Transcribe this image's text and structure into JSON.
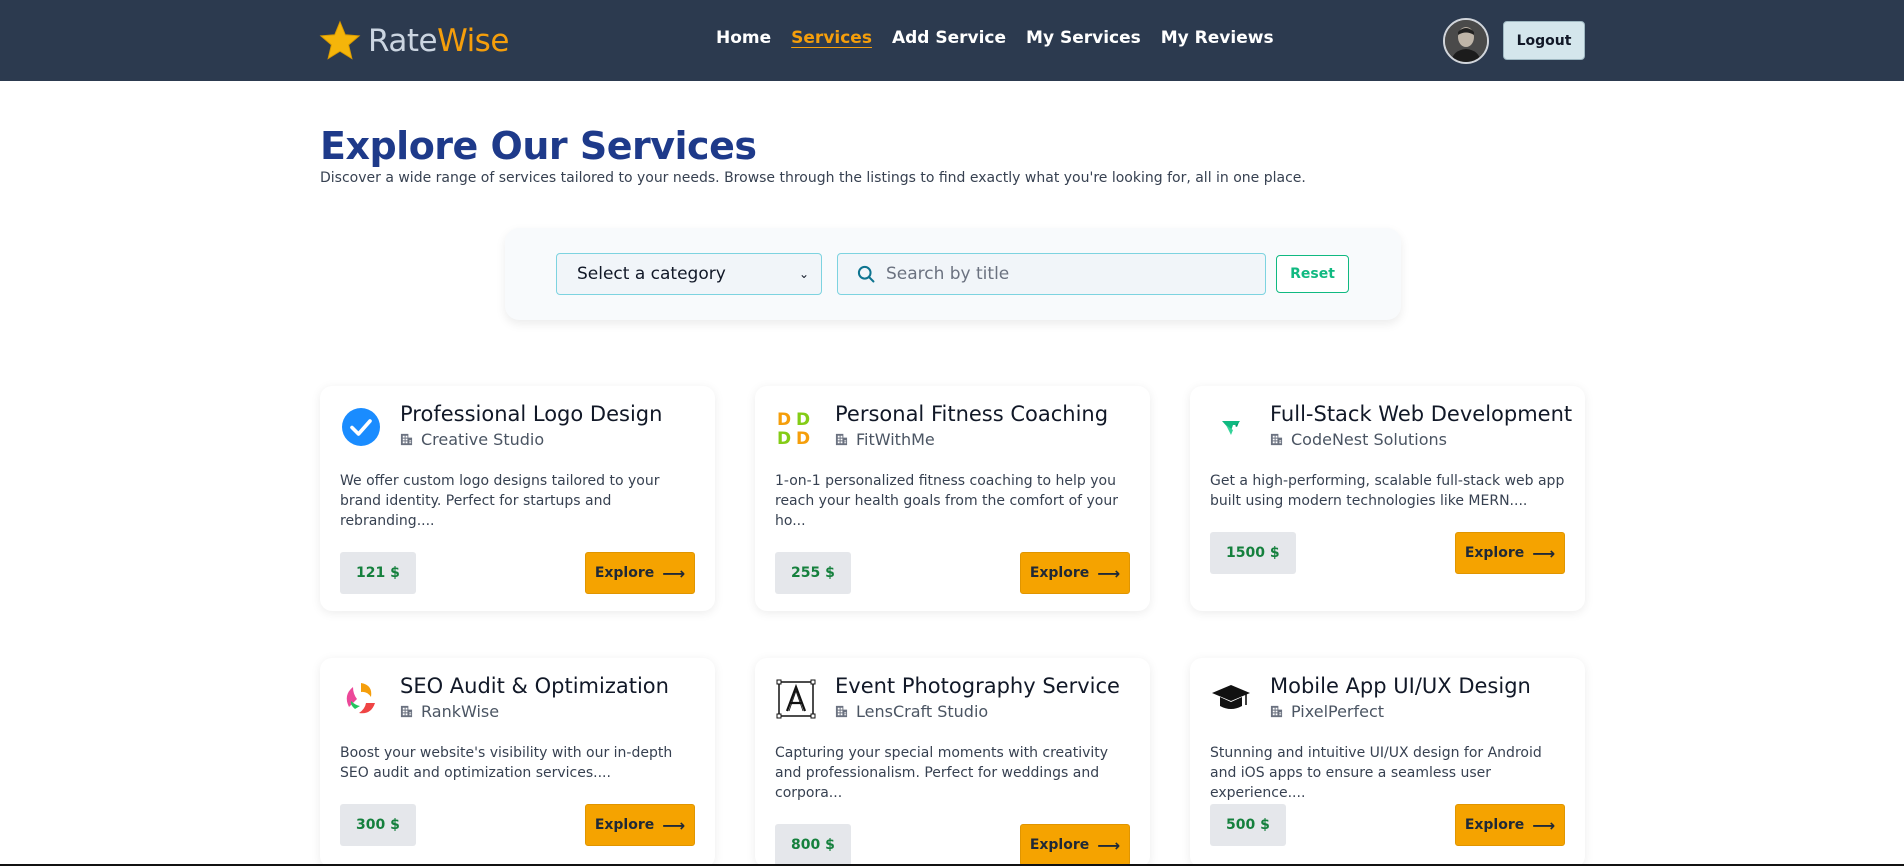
{
  "brand": {
    "rate": "Rate",
    "wise": "Wise",
    "star_color": "#f5b50a"
  },
  "nav": {
    "links": [
      {
        "label": "Home",
        "active": false
      },
      {
        "label": "Services",
        "active": true
      },
      {
        "label": "Add Service",
        "active": false
      },
      {
        "label": "My Services",
        "active": false
      },
      {
        "label": "My Reviews",
        "active": false
      }
    ],
    "logout_label": "Logout"
  },
  "header": {
    "title": "Explore Our Services",
    "subtitle": "Discover a wide range of services tailored to your needs. Browse through the listings to find exactly what you're looking for, all in one place."
  },
  "filters": {
    "category_selected": "Select a category",
    "search_placeholder": "Search by title",
    "reset_label": "Reset"
  },
  "services": [
    {
      "title": "Professional Logo Design",
      "company": "Creative Studio",
      "description": "We offer custom logo designs tailored to your brand identity. Perfect for startups and rebranding....",
      "price": "121 $",
      "explore_label": "Explore",
      "icon": "checkmark-badge-icon"
    },
    {
      "title": "Personal Fitness Coaching",
      "company": "FitWithMe",
      "description": "1-on-1 personalized fitness coaching to help you reach your health goals from the comfort of your ho...",
      "price": "255 $",
      "explore_label": "Explore",
      "icon": "dd-pattern-icon"
    },
    {
      "title": "Full-Stack Web Development",
      "company": "CodeNest Solutions",
      "description": "Get a high-performing, scalable full-stack web app built using modern technologies like MERN....",
      "price": "1500 $",
      "explore_label": "Explore",
      "icon": "green-v-icon"
    },
    {
      "title": "SEO Audit & Optimization",
      "company": "RankWise",
      "description": "Boost your website's visibility with our in-depth SEO audit and optimization services....",
      "price": "300 $",
      "explore_label": "Explore",
      "icon": "swirl-icon"
    },
    {
      "title": "Event Photography Service",
      "company": "LensCraft Studio",
      "description": "Capturing your special moments with creativity and professionalism. Perfect for weddings and corpora...",
      "price": "800 $",
      "explore_label": "Explore",
      "icon": "letter-a-frame-icon"
    },
    {
      "title": "Mobile App UI/UX Design",
      "company": "PixelPerfect",
      "description": "Stunning and intuitive UI/UX design for Android and iOS apps to ensure a seamless user experience....",
      "price": "500 $",
      "explore_label": "Explore",
      "icon": "graduation-cap-icon"
    }
  ]
}
